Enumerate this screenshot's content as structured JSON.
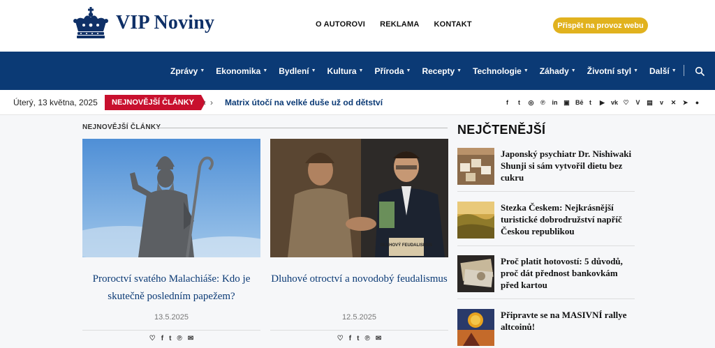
{
  "brand": {
    "name": "VIP Noviny"
  },
  "top_nav": [
    "O AUTOROVI",
    "REKLAMA",
    "KONTAKT"
  ],
  "support_button": "Přispět na provoz webu",
  "main_nav": [
    "Zprávy",
    "Ekonomika",
    "Bydlení",
    "Kultura",
    "Příroda",
    "Recepty",
    "Technologie",
    "Záhady",
    "Životní styl",
    "Další"
  ],
  "ticker": {
    "date": "Úterý, 13 května, 2025",
    "label": "NEJNOVĚJŠÍ ČLÁNKY",
    "headline": "Matrix útočí na velké duše už od dětství"
  },
  "socials": [
    "facebook-icon",
    "twitter-icon",
    "instagram-icon",
    "pinterest-icon",
    "linkedin-icon",
    "flickr-icon",
    "behance-icon",
    "tumblr-icon",
    "youtube-icon",
    "vk-icon",
    "heart-icon",
    "vine-icon",
    "twitch-icon",
    "vimeo-icon",
    "xing-icon",
    "telegram-icon",
    "reddit-icon"
  ],
  "latest": {
    "title": "NEJNOVĚJŠÍ ČLÁNKY",
    "articles": [
      {
        "title": "Proroctví svatého Malachiáše: Kdo je skutečně posledním papežem?",
        "date": "13.5.2025"
      },
      {
        "title": "Dluhové otroctví a novodobý feudalismus",
        "date": "12.5.2025",
        "image_sign": "DLUHOVÝ FEUDALISMUS"
      }
    ]
  },
  "most_read": {
    "title": "NEJČTENĚJŠÍ",
    "items": [
      {
        "title": "Japonský psychiatr Dr. Nishiwaki Shunji si sám vytvořil dietu bez cukru"
      },
      {
        "title": "Stezka Českem: Nejkrásnější turistické dobrodružství napříč Českou republikou"
      },
      {
        "title": "Proč platit hotovostí: 5 důvodů, proč dát přednost bankovkám před kartou"
      },
      {
        "title": "Připravte se na MASIVNÍ rallye altcoinů!"
      }
    ]
  },
  "colors": {
    "navy": "#0b3a75",
    "red": "#c8102e",
    "gold": "#e1b21e"
  }
}
